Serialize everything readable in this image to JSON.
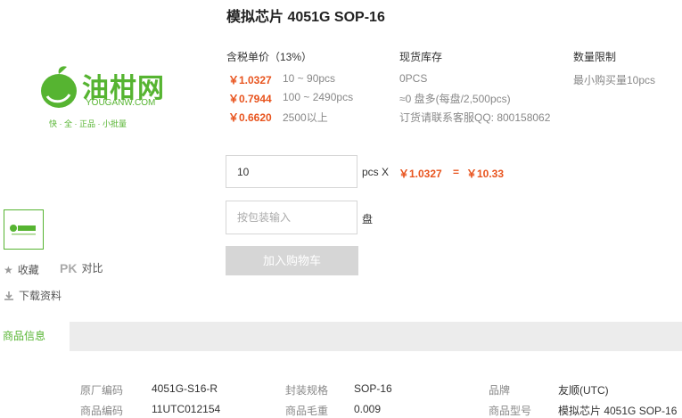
{
  "product": {
    "title": "模拟芯片 4051G SOP-16"
  },
  "logo": {
    "brand_cn": "油柑网",
    "brand_en": "YOUGANW.COM",
    "slogan": "快 · 全 · 正品 · 小批量"
  },
  "pricing": {
    "header": "含税单价（13%）",
    "tiers": [
      {
        "price": "￥1.0327",
        "range": "10 ~ 90pcs"
      },
      {
        "price": "￥0.7944",
        "range": "100 ~ 2490pcs"
      },
      {
        "price": "￥0.6620",
        "range": "2500以上"
      }
    ]
  },
  "stock": {
    "header": "现货库存",
    "lines": [
      "0PCS",
      "≈0 盘多(每盘/2,500pcs)",
      "订货请联系客服QQ: 800158062"
    ]
  },
  "limit": {
    "header": "数量限制",
    "text": "最小购买量10pcs"
  },
  "order": {
    "qty_value": "10",
    "unit": "pcs X",
    "unit_price": "￥1.0327",
    "eq": "=",
    "total": "￥10.33",
    "pkg_placeholder": "按包装输入",
    "pkg_unit": "盘",
    "cart_label": "加入购物车"
  },
  "actions": {
    "favorite": "收藏",
    "pk": "PK",
    "compare": "对比",
    "download": "下载资料"
  },
  "tabs": {
    "info": "商品信息"
  },
  "specs": {
    "row1": [
      {
        "label": "原厂编码",
        "value": "4051G-S16-R"
      },
      {
        "label": "封装规格",
        "value": "SOP-16"
      },
      {
        "label": "品牌",
        "value": "友顺(UTC)"
      }
    ],
    "row2": [
      {
        "label": "商品编码",
        "value": "11UTC012154"
      },
      {
        "label": "商品毛重",
        "value": "0.009"
      },
      {
        "label": "商品型号",
        "value": "模拟芯片 4051G SOP-16"
      }
    ]
  },
  "colors": {
    "accent": "#56b431",
    "price": "#e8541e"
  }
}
